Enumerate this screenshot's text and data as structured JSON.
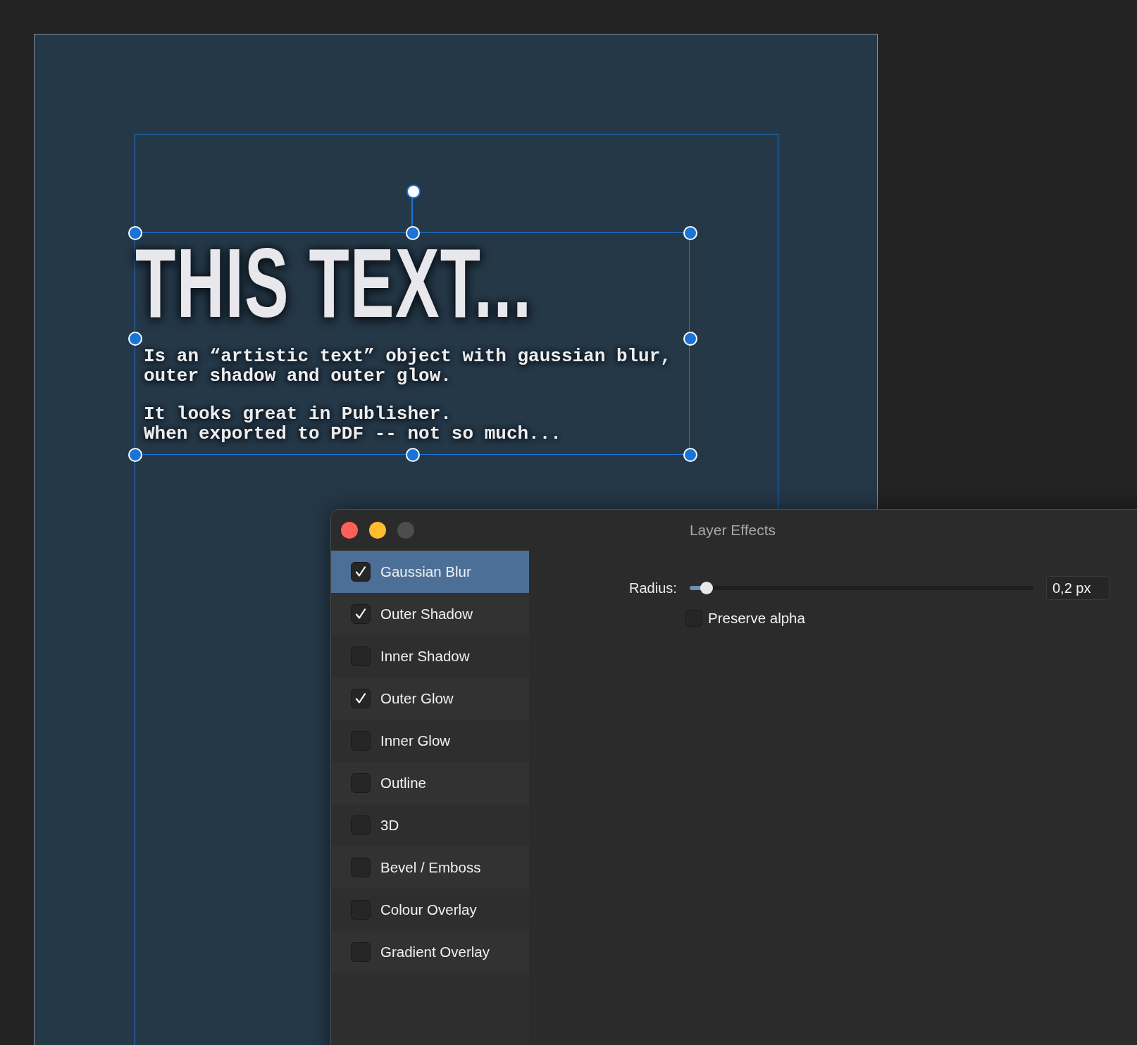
{
  "canvas": {
    "heading": "THIS TEXT...",
    "paragraphs": [
      [
        "Is an “artistic text” object with gaussian blur,",
        "outer shadow and outer glow."
      ],
      [
        "It looks great in Publisher.",
        "When exported to PDF -- not so much..."
      ]
    ]
  },
  "dialog": {
    "title": "Layer Effects",
    "effects": [
      {
        "label": "Gaussian Blur",
        "checked": true,
        "selected": true
      },
      {
        "label": "Outer Shadow",
        "checked": true,
        "selected": false
      },
      {
        "label": "Inner Shadow",
        "checked": false,
        "selected": false
      },
      {
        "label": "Outer Glow",
        "checked": true,
        "selected": false
      },
      {
        "label": "Inner Glow",
        "checked": false,
        "selected": false
      },
      {
        "label": "Outline",
        "checked": false,
        "selected": false
      },
      {
        "label": "3D",
        "checked": false,
        "selected": false
      },
      {
        "label": "Bevel / Emboss",
        "checked": false,
        "selected": false
      },
      {
        "label": "Colour Overlay",
        "checked": false,
        "selected": false
      },
      {
        "label": "Gradient Overlay",
        "checked": false,
        "selected": false
      }
    ],
    "radius": {
      "label": "Radius:",
      "level": 0.05,
      "value": "0,2 px"
    },
    "preserve_alpha": {
      "label": "Preserve alpha",
      "checked": false
    }
  }
}
